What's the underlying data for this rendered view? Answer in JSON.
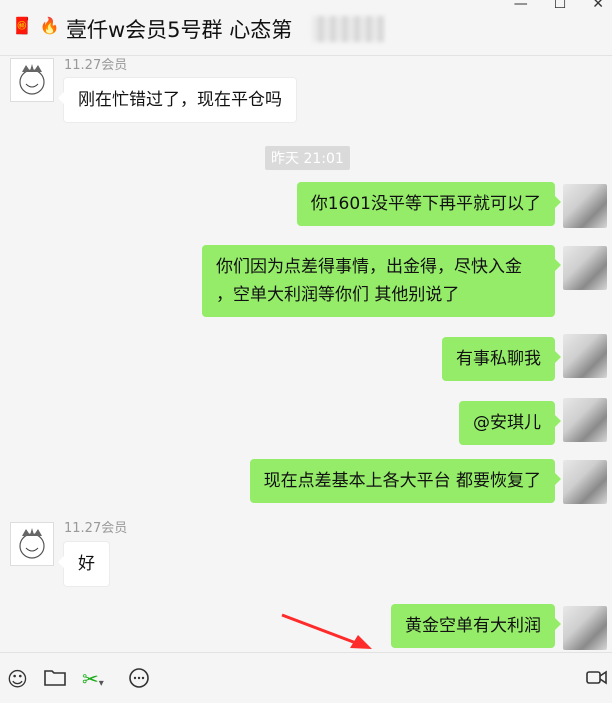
{
  "window": {
    "title": "壹仟w会员5号群 心态第",
    "title_icons": [
      "red-envelope-icon",
      "fire-icon"
    ],
    "controls": {
      "minimize": "—",
      "maximize": "☐",
      "close": "✕"
    }
  },
  "chat": {
    "time_separator": "昨天 21:01",
    "messages": [
      {
        "sender": "11.27会员",
        "direction": "in",
        "text": "刚在忙错过了，现在平仓吗"
      },
      {
        "direction": "out",
        "text": "你1601没平等下再平就可以了"
      },
      {
        "direction": "out",
        "text_lines": [
          "你们因为点差得事情，出金得，尽快入金",
          "，空单大利润等你们 其他别说了"
        ]
      },
      {
        "direction": "out",
        "text": "有事私聊我"
      },
      {
        "direction": "out",
        "text": "@安琪儿"
      },
      {
        "direction": "out",
        "text": "现在点差基本上各大平台 都要恢复了"
      },
      {
        "sender": "11.27会员",
        "direction": "in",
        "text": "好"
      },
      {
        "direction": "out",
        "text": "黄金空单有大利润"
      }
    ]
  },
  "toolbar": {
    "icons": [
      "emoji-icon",
      "folder-icon",
      "scissors-icon",
      "chat-bubble-icon",
      "video-call-icon"
    ]
  },
  "colors": {
    "out_bubble": "#95ec69",
    "in_bubble": "#ffffff",
    "background": "#f5f5f5",
    "arrow": "#ff2a2a"
  }
}
